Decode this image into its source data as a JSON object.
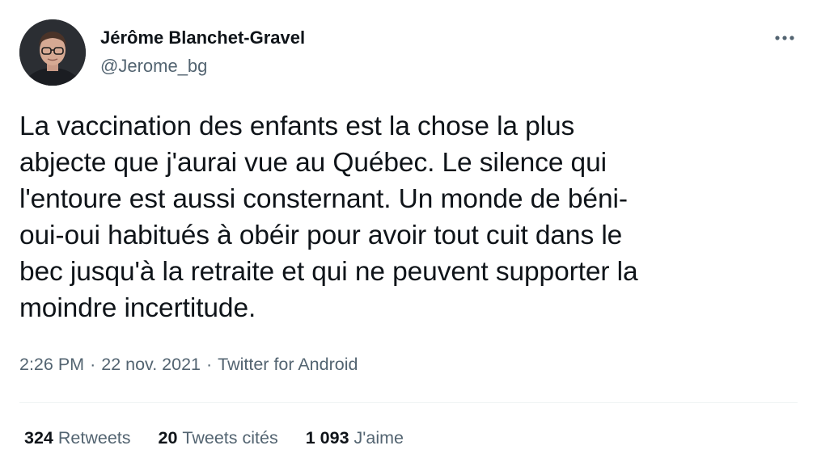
{
  "author": {
    "display_name": "Jérôme Blanchet-Gravel",
    "handle": "@Jerome_bg"
  },
  "tweet": {
    "text": "La vaccination des enfants est la chose la plus\nabjecte que j'aurai vue au Québec. Le silence qui\nl'entoure est aussi consternant. Un monde de béni-\noui-oui habitués à obéir pour avoir tout cuit dans le\nbec jusqu'à la retraite et qui ne peuvent supporter la\nmoindre incertitude."
  },
  "meta": {
    "time": "2:26 PM",
    "separator": "·",
    "date": "22 nov. 2021",
    "source": "Twitter for Android"
  },
  "stats": {
    "retweets": {
      "count": "324",
      "label": "Retweets"
    },
    "quotes": {
      "count": "20",
      "label": "Tweets cités"
    },
    "likes": {
      "count": "1 093",
      "label": "J'aime"
    }
  },
  "icons": {
    "more": "more-horizontal-icon"
  },
  "colors": {
    "text_primary": "#0f1419",
    "text_secondary": "#536471",
    "divider": "#eff3f4"
  }
}
